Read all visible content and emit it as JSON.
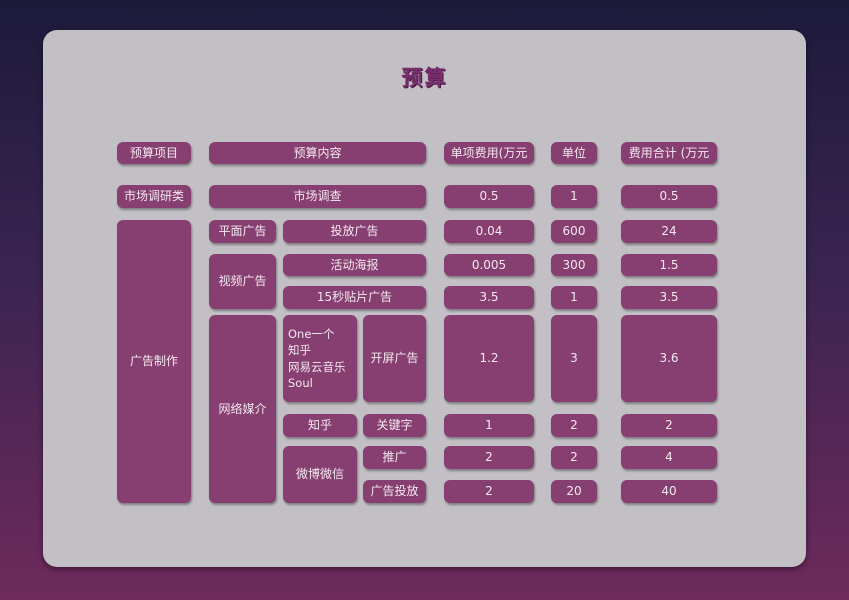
{
  "title": "预算",
  "header": {
    "item": "预算项目",
    "content": "预算内容",
    "unit_price": "单项费用(万元",
    "unit": "单位",
    "total": "费用合计 (万元"
  },
  "categories": {
    "research": "市场调研类",
    "ad_production": "广告制作"
  },
  "subcategories": {
    "print": "平面广告",
    "video": "视频广告",
    "online": "网络媒介"
  },
  "items": {
    "survey": "市场调查",
    "placement": "投放广告",
    "poster": "活动海报",
    "preroll": "15秒贴片广告",
    "platforms": [
      "One一个",
      "知乎",
      "网易云音乐",
      "Soul"
    ],
    "splash": "开屏广告",
    "zhihu": "知乎",
    "keyword": "关键字",
    "weibo_wechat": "微博微信",
    "promotion": "推广",
    "ad_placement": "广告投放"
  },
  "rows": [
    {
      "unit_price": "0.5",
      "unit": "1",
      "total": "0.5"
    },
    {
      "unit_price": "0.04",
      "unit": "600",
      "total": "24"
    },
    {
      "unit_price": "0.005",
      "unit": "300",
      "total": "1.5"
    },
    {
      "unit_price": "3.5",
      "unit": "1",
      "total": "3.5"
    },
    {
      "unit_price": "1.2",
      "unit": "3",
      "total": "3.6"
    },
    {
      "unit_price": "1",
      "unit": "2",
      "total": "2"
    },
    {
      "unit_price": "2",
      "unit": "2",
      "total": "4"
    },
    {
      "unit_price": "2",
      "unit": "20",
      "total": "40"
    }
  ]
}
